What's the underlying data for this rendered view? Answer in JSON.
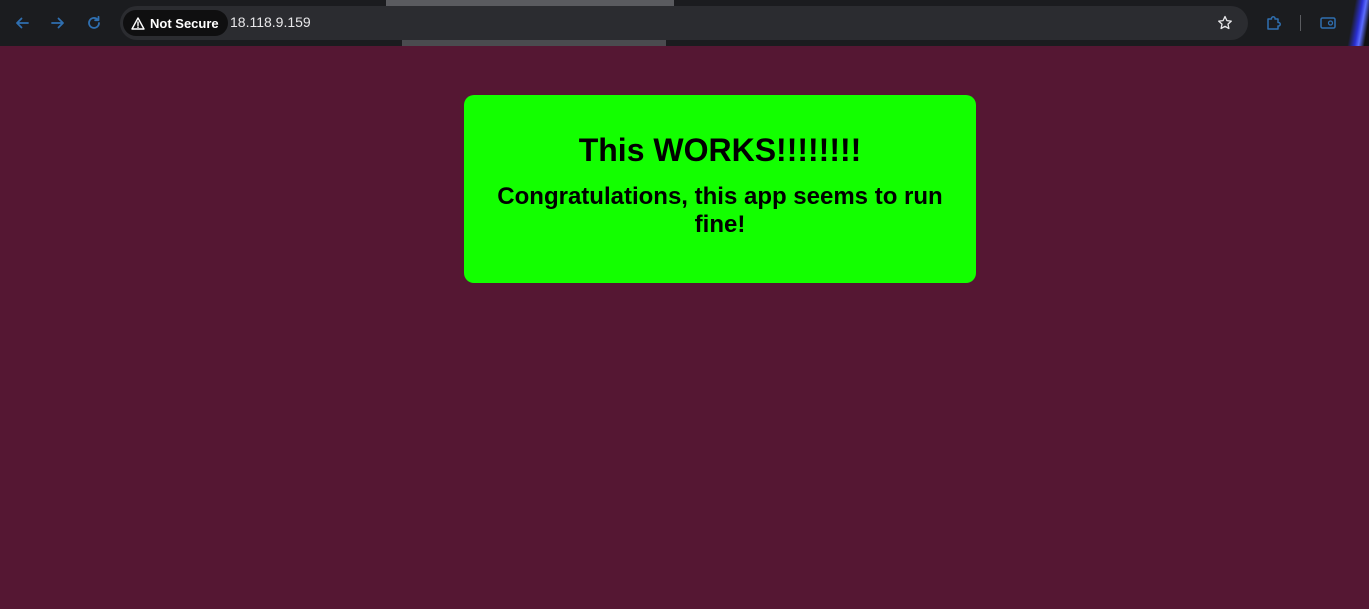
{
  "browser": {
    "security_label": "Not Secure",
    "url": "18.118.9.159",
    "icons": {
      "back": "arrow-left-icon",
      "forward": "arrow-right-icon",
      "reload": "reload-icon",
      "security": "warning-triangle-icon",
      "bookmark": "star-icon",
      "extensions": "puzzle-icon",
      "profile": "profile-icon"
    }
  },
  "page": {
    "heading": "This WORKS!!!!!!!!",
    "message": "Congratulations, this app seems to run fine!"
  },
  "colors": {
    "page_background": "#551733",
    "card_background": "#13ff00",
    "text": "#000000",
    "toolbar": "#1b1c1f"
  }
}
